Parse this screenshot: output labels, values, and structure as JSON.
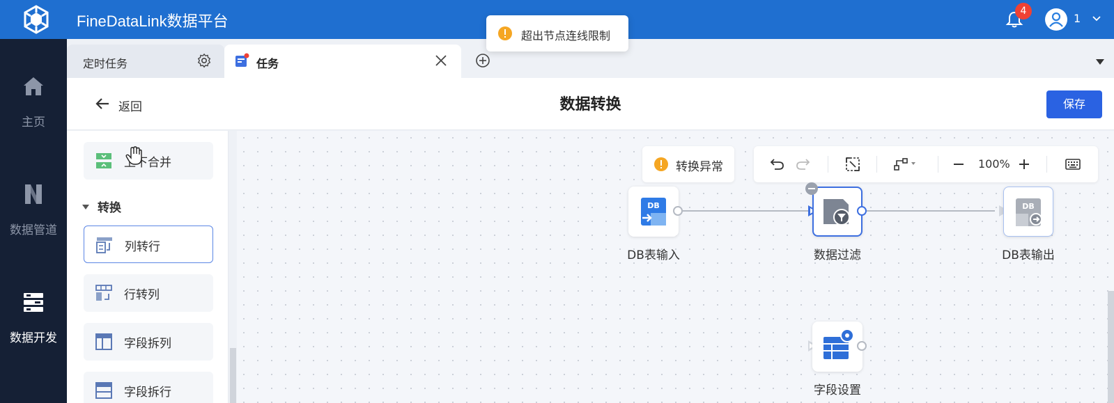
{
  "app": {
    "title": "FineDataLink数据平台",
    "notification_count": "4",
    "user_name": "1"
  },
  "nav": {
    "items": [
      {
        "label": "主页",
        "icon": "home-icon"
      },
      {
        "label": "数据管道",
        "icon": "pipeline-icon"
      },
      {
        "label": "数据开发",
        "icon": "data-dev-icon",
        "active": true
      }
    ]
  },
  "tabs": [
    {
      "label": "定时任务"
    },
    {
      "label": "任务"
    }
  ],
  "content": {
    "back_label": "返回",
    "title": "数据转换",
    "save_label": "保存"
  },
  "palette": {
    "top_item": "上下合并",
    "section_title": "转换",
    "items": [
      {
        "label": "列转行",
        "selected": true
      },
      {
        "label": "行转列"
      },
      {
        "label": "字段拆列"
      },
      {
        "label": "字段拆行"
      }
    ]
  },
  "canvas": {
    "warning_chip": "转换异常",
    "zoom": "100%",
    "nodes": [
      {
        "label": "DB表输入"
      },
      {
        "label": "数据过滤"
      },
      {
        "label": "DB表输出"
      },
      {
        "label": "字段设置"
      }
    ]
  },
  "toast": {
    "message": "超出节点连线限制"
  },
  "colors": {
    "header": "#1f6fd0",
    "nav": "#152035",
    "primary": "#2a62e2",
    "warning": "#f5a623"
  }
}
